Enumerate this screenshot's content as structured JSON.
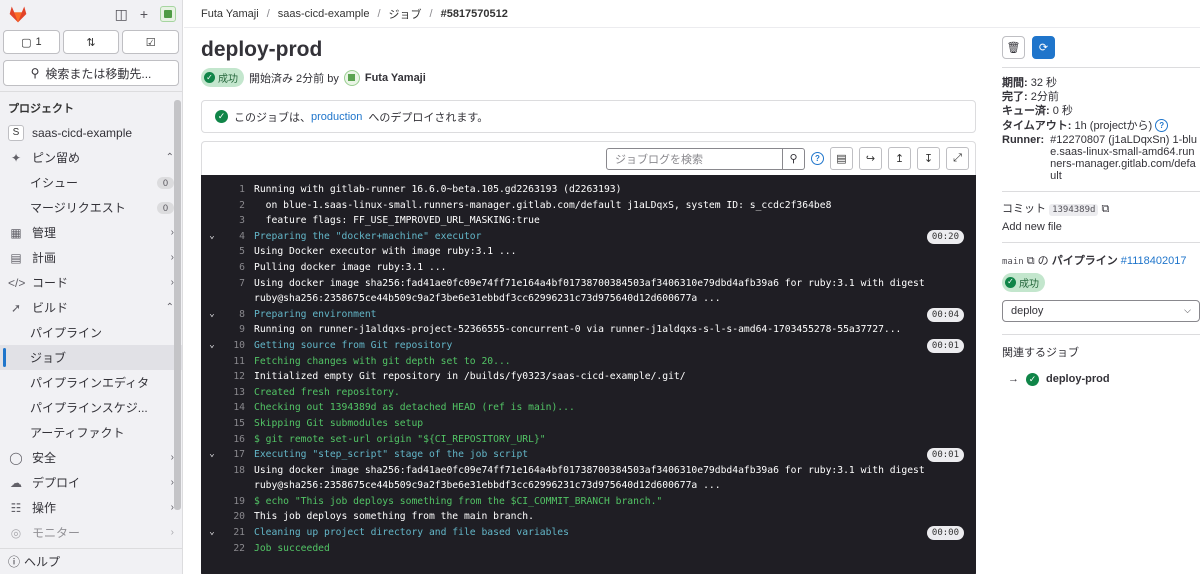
{
  "sidebar": {
    "counters": [
      {
        "icon": "issues-icon",
        "count": "1"
      },
      {
        "icon": "merge-request-icon",
        "count": ""
      },
      {
        "icon": "todo-icon",
        "count": ""
      }
    ],
    "search_label": "検索または移動先...",
    "section_title": "プロジェクト",
    "project_letter": "S",
    "project_name": "saas-cicd-example",
    "items": [
      {
        "label": "ピン留め"
      },
      {
        "label": "イシュー",
        "badge": "0"
      },
      {
        "label": "マージリクエスト",
        "badge": "0"
      },
      {
        "label": "管理"
      },
      {
        "label": "計画"
      },
      {
        "label": "コード"
      },
      {
        "label": "ビルド"
      },
      {
        "label": "パイプライン"
      },
      {
        "label": "ジョブ"
      },
      {
        "label": "パイプラインエディタ"
      },
      {
        "label": "パイプラインスケジ..."
      },
      {
        "label": "アーティファクト"
      },
      {
        "label": "安全"
      },
      {
        "label": "デプロイ"
      },
      {
        "label": "操作"
      },
      {
        "label": "モニター"
      }
    ],
    "help": "ヘルプ"
  },
  "breadcrumb": [
    "Futa Yamaji",
    "saas-cicd-example",
    "ジョブ",
    "#5817570512"
  ],
  "job": {
    "title": "deploy-prod",
    "status": "成功",
    "started": "開始済み 2分前 by",
    "user": "Futa Yamaji",
    "alert_prefix": "このジョブは、",
    "alert_link": "production",
    "alert_suffix": "へのデプロイされます。"
  },
  "log_search_placeholder": "ジョブログを検索",
  "log_lines": [
    {
      "n": "1",
      "t": "Running with gitlab-runner 16.6.0~beta.105.gd2263193 (d2263193)",
      "k": ""
    },
    {
      "n": "2",
      "t": "  on blue-1.saas-linux-small.runners-manager.gitlab.com/default j1aLDqxS, system ID: s_ccdc2f364be8",
      "k": ""
    },
    {
      "n": "3",
      "t": "  feature flags: FF_USE_IMPROVED_URL_MASKING:true",
      "k": ""
    },
    {
      "n": "4",
      "t": "Preparing the \"docker+machine\" executor",
      "k": "sec",
      "d": "00:20"
    },
    {
      "n": "5",
      "t": "Using Docker executor with image ruby:3.1 ...",
      "k": ""
    },
    {
      "n": "6",
      "t": "Pulling docker image ruby:3.1 ...",
      "k": ""
    },
    {
      "n": "7",
      "t": "Using docker image sha256:fad41ae0fc09e74ff71e164a4bf01738700384503af3406310e79dbd4afb39a6 for ruby:3.1 with digest ruby@sha256:2358675ce44b509c9a2f3be6e31ebbdf3cc62996231c73d975640d12d600677a ...",
      "k": ""
    },
    {
      "n": "8",
      "t": "Preparing environment",
      "k": "sec",
      "d": "00:04"
    },
    {
      "n": "9",
      "t": "Running on runner-j1aldqxs-project-52366555-concurrent-0 via runner-j1aldqxs-s-l-s-amd64-1703455278-55a37727...",
      "k": ""
    },
    {
      "n": "10",
      "t": "Getting source from Git repository",
      "k": "sec",
      "d": "00:01"
    },
    {
      "n": "11",
      "t": "Fetching changes with git depth set to 20...",
      "k": "green"
    },
    {
      "n": "12",
      "t": "Initialized empty Git repository in /builds/fy0323/saas-cicd-example/.git/",
      "k": ""
    },
    {
      "n": "13",
      "t": "Created fresh repository.",
      "k": "green"
    },
    {
      "n": "14",
      "t": "Checking out 1394389d as detached HEAD (ref is main)...",
      "k": "green"
    },
    {
      "n": "15",
      "t": "Skipping Git submodules setup",
      "k": "green"
    },
    {
      "n": "16",
      "t": "$ git remote set-url origin \"${CI_REPOSITORY_URL}\"",
      "k": "green"
    },
    {
      "n": "17",
      "t": "Executing \"step_script\" stage of the job script",
      "k": "sec",
      "d": "00:01"
    },
    {
      "n": "18",
      "t": "Using docker image sha256:fad41ae0fc09e74ff71e164a4bf01738700384503af3406310e79dbd4afb39a6 for ruby:3.1 with digest ruby@sha256:2358675ce44b509c9a2f3be6e31ebbdf3cc62996231c73d975640d12d600677a ...",
      "k": ""
    },
    {
      "n": "19",
      "t": "$ echo \"This job deploys something from the $CI_COMMIT_BRANCH branch.\"",
      "k": "green"
    },
    {
      "n": "20",
      "t": "This job deploys something from the main branch.",
      "k": ""
    },
    {
      "n": "21",
      "t": "Cleaning up project directory and file based variables",
      "k": "sec",
      "d": "00:00"
    },
    {
      "n": "22",
      "t": "Job succeeded",
      "k": "green"
    }
  ],
  "info": {
    "duration_label": "期間:",
    "duration": "32 秒",
    "finished_label": "完了:",
    "finished": "2分前",
    "queued_label": "キュー済:",
    "queued": "0 秒",
    "timeout_label": "タイムアウト:",
    "timeout": "1h (projectから)",
    "runner_label": "Runner:",
    "runner": "#12270807 (j1aLDqxSn) 1-blue.saas-linux-small-amd64.runners-manager.gitlab.com/default",
    "commit_label": "コミット",
    "commit_sha": "1394389d",
    "commit_msg": "Add new file",
    "branch": "main",
    "pipeline_mid": "の",
    "pipeline_label": "パイプライン",
    "pipeline_id": "#1118402017",
    "pipeline_status": "成功",
    "stage": "deploy",
    "related_title": "関連するジョブ",
    "related_job": "deploy-prod"
  },
  "colors": {
    "accent": "#1f75cb",
    "success": "#108548",
    "log_bg": "#1f1e24"
  }
}
